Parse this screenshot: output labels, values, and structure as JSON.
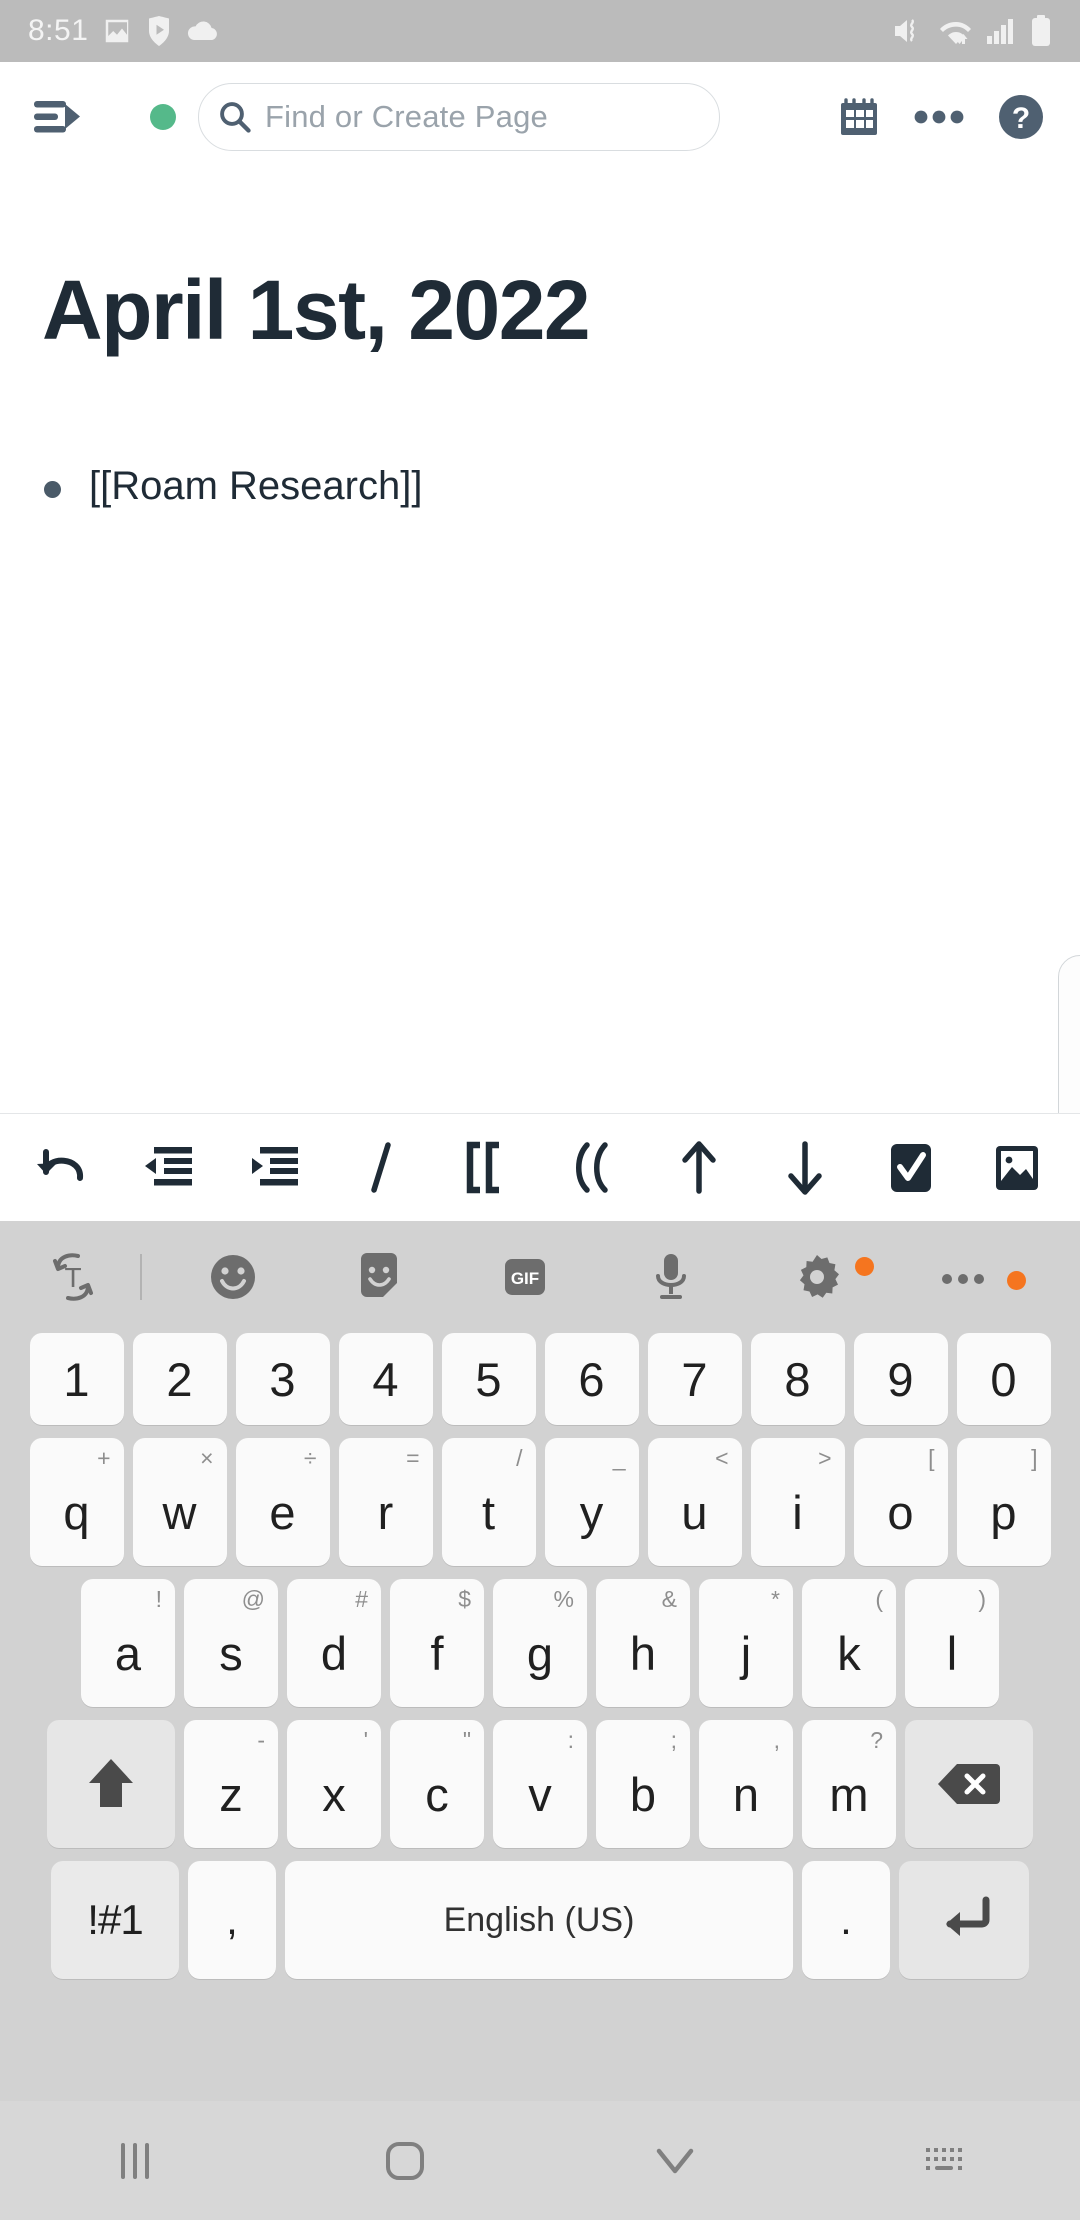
{
  "status_bar": {
    "time": "8:51",
    "left_icons": [
      "image-icon",
      "play-store-icon",
      "cloud-icon"
    ],
    "right_icons": [
      "mute-vibrate-icon",
      "wifi-icon",
      "signal-bars-icon",
      "battery-icon"
    ],
    "background": "#bbbbbb"
  },
  "nav": {
    "menu_icon": "sidebar-toggle-icon",
    "status_dot_color": "#55b98a",
    "search_placeholder": "Find or Create Page",
    "search_icon": "search-icon",
    "calendar_icon": "calendar-icon",
    "more_icon": "more-horizontal-icon",
    "help_icon": "help-circle-icon",
    "icon_color": "#4f6071"
  },
  "page": {
    "title": "April 1st, 2022",
    "blocks": [
      {
        "text": "[[Roam Research]]"
      }
    ]
  },
  "editor_toolbar": {
    "buttons": [
      {
        "name": "undo-button",
        "icon": "undo-icon"
      },
      {
        "name": "outdent-button",
        "icon": "outdent-icon"
      },
      {
        "name": "indent-button",
        "icon": "indent-icon"
      },
      {
        "name": "slash-command-button",
        "icon": "slash-icon",
        "label": "/"
      },
      {
        "name": "page-link-button",
        "icon": "double-bracket-icon",
        "label": "[["
      },
      {
        "name": "block-ref-button",
        "icon": "double-paren-icon",
        "label": "(("
      },
      {
        "name": "move-up-button",
        "icon": "arrow-up-icon"
      },
      {
        "name": "move-down-button",
        "icon": "arrow-down-icon"
      },
      {
        "name": "todo-button",
        "icon": "checkbox-checked-icon"
      },
      {
        "name": "image-button",
        "icon": "image-icon"
      }
    ]
  },
  "keyboard": {
    "background": "#d2d2d2",
    "key_background": "#fafafa",
    "mod_key_background": "#e6e6e6",
    "badge_color": "#f5751f",
    "toolbar": [
      {
        "name": "translate-button",
        "icon": "translate-icon",
        "badge": false
      },
      {
        "name": "emoji-button",
        "icon": "emoji-smiley-icon",
        "badge": false
      },
      {
        "name": "sticker-button",
        "icon": "sticker-icon",
        "badge": false
      },
      {
        "name": "gif-button",
        "icon": "gif-icon",
        "label": "GIF",
        "badge": false
      },
      {
        "name": "voice-input-button",
        "icon": "microphone-icon",
        "badge": false
      },
      {
        "name": "keyboard-settings-button",
        "icon": "gear-icon",
        "badge": true
      },
      {
        "name": "keyboard-more-button",
        "icon": "more-horizontal-icon",
        "badge": true
      }
    ],
    "row_numbers": [
      "1",
      "2",
      "3",
      "4",
      "5",
      "6",
      "7",
      "8",
      "9",
      "0"
    ],
    "row_q": [
      {
        "main": "q",
        "sup": "+"
      },
      {
        "main": "w",
        "sup": "×"
      },
      {
        "main": "e",
        "sup": "÷"
      },
      {
        "main": "r",
        "sup": "="
      },
      {
        "main": "t",
        "sup": "/"
      },
      {
        "main": "y",
        "sup": "_"
      },
      {
        "main": "u",
        "sup": "<"
      },
      {
        "main": "i",
        "sup": ">"
      },
      {
        "main": "o",
        "sup": "["
      },
      {
        "main": "p",
        "sup": "]"
      }
    ],
    "row_a": [
      {
        "main": "a",
        "sup": "!"
      },
      {
        "main": "s",
        "sup": "@"
      },
      {
        "main": "d",
        "sup": "#"
      },
      {
        "main": "f",
        "sup": "$"
      },
      {
        "main": "g",
        "sup": "%"
      },
      {
        "main": "h",
        "sup": "&"
      },
      {
        "main": "j",
        "sup": "*"
      },
      {
        "main": "k",
        "sup": "("
      },
      {
        "main": "l",
        "sup": ")"
      }
    ],
    "row_z": [
      {
        "main": "z",
        "sup": "-"
      },
      {
        "main": "x",
        "sup": "'"
      },
      {
        "main": "c",
        "sup": "\""
      },
      {
        "main": "v",
        "sup": ":"
      },
      {
        "main": "b",
        "sup": ";"
      },
      {
        "main": "n",
        "sup": ","
      },
      {
        "main": "m",
        "sup": "?"
      }
    ],
    "shift_icon": "shift-arrow-up-icon",
    "backspace_icon": "backspace-icon",
    "symbols_key": "!#1",
    "comma_key": ",",
    "space_key": "English (US)",
    "period_key": ".",
    "enter_icon": "enter-return-icon"
  },
  "system_nav": {
    "recents_icon": "recents-icon",
    "home_icon": "home-icon",
    "hide-keyboard_icon": "chevron-down-icon",
    "keyboard_switch_icon": "keyboard-switcher-icon",
    "background": "#d7d7d7"
  }
}
